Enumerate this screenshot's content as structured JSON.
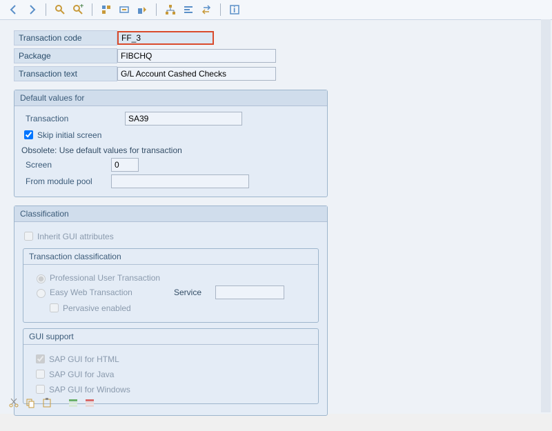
{
  "toolbar": {
    "items": [
      "back",
      "forward",
      "sep",
      "find",
      "find-next",
      "sep",
      "where-used",
      "other",
      "export",
      "sep",
      "hierarchy",
      "align",
      "switch",
      "sep",
      "info"
    ]
  },
  "header": {
    "tcode_label": "Transaction code",
    "tcode_value": "FF_3",
    "package_label": "Package",
    "package_value": "FIBCHQ",
    "text_label": "Transaction text",
    "text_value": "G/L Account Cashed Checks"
  },
  "defaults": {
    "title": "Default values for",
    "transaction_label": "Transaction",
    "transaction_value": "SA39",
    "skip_label": "Skip initial screen",
    "skip_checked": true,
    "obsolete_text": "Obsolete: Use default values for transaction",
    "screen_label": "Screen",
    "screen_value": "0",
    "pool_label": "From module pool",
    "pool_value": ""
  },
  "classification": {
    "title": "Classification",
    "inherit_label": "Inherit GUI attributes",
    "inherit_checked": false,
    "tc_title": "Transaction classification",
    "professional_label": "Professional User Transaction",
    "easy_label": "Easy Web Transaction",
    "service_label": "Service",
    "service_value": "",
    "pervasive_label": "Pervasive enabled",
    "gui_title": "GUI support",
    "gui_html_label": "SAP GUI for HTML",
    "gui_html_checked": true,
    "gui_java_label": "SAP GUI for Java",
    "gui_java_checked": false,
    "gui_win_label": "SAP GUI for Windows",
    "gui_win_checked": false
  },
  "bottom_toolbar": {
    "items": [
      "cut",
      "copy",
      "paste",
      "sep",
      "insert",
      "delete"
    ]
  }
}
